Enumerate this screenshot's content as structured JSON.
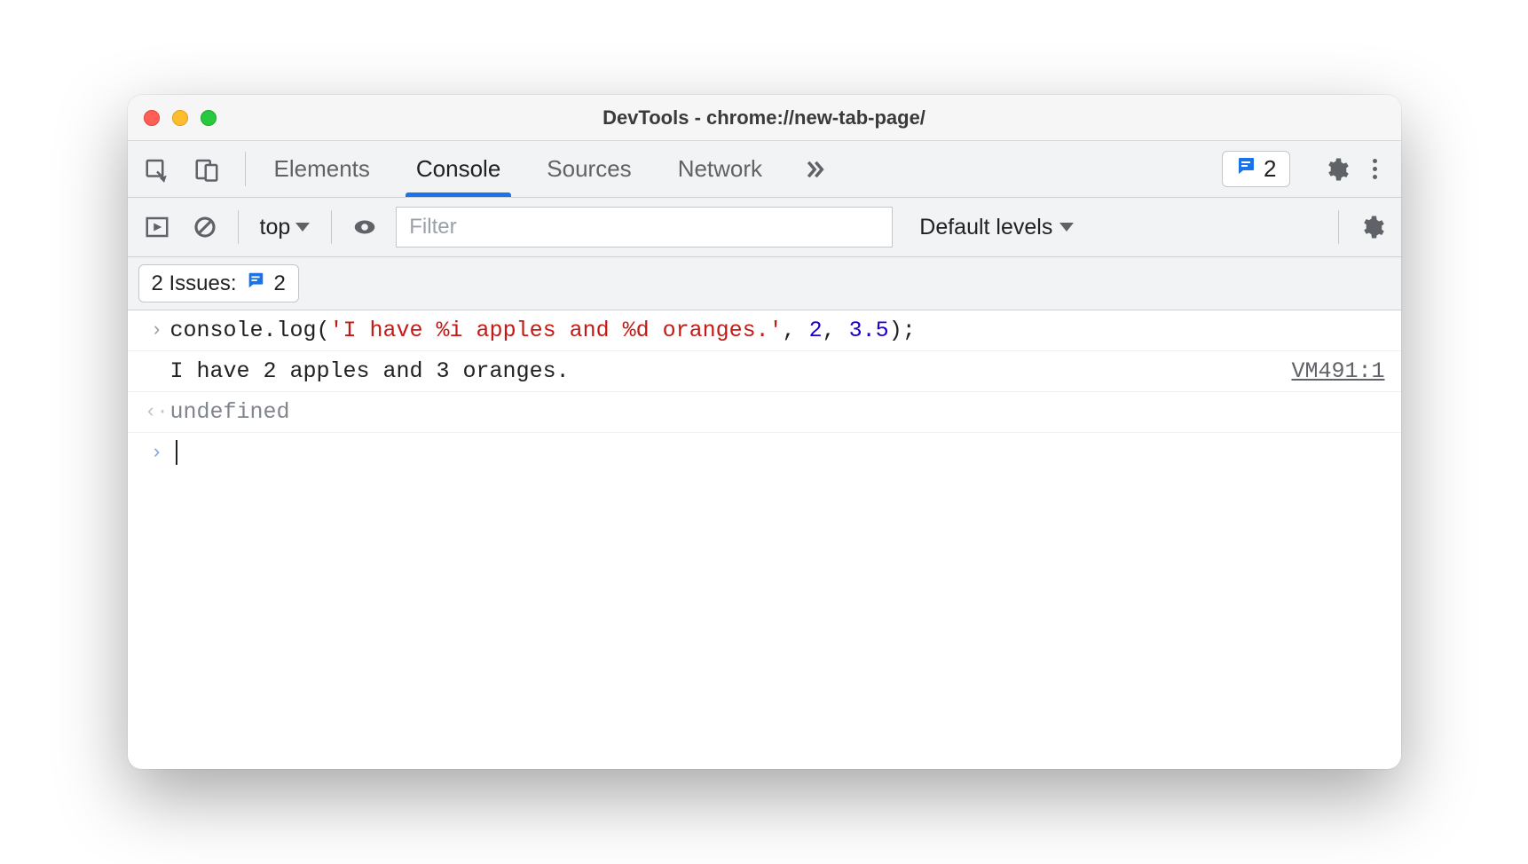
{
  "window": {
    "title": "DevTools - chrome://new-tab-page/"
  },
  "tabs": {
    "elements": "Elements",
    "console": "Console",
    "sources": "Sources",
    "network": "Network",
    "active": "console"
  },
  "issues_count": "2",
  "toolbar": {
    "context": "top",
    "filter_placeholder": "Filter",
    "levels": "Default levels"
  },
  "issues_chip": {
    "label": "2 Issues:",
    "count": "2"
  },
  "console": {
    "input": {
      "fn": "console.log(",
      "str": "'I have %i apples and %d oranges.'",
      "sep1": ", ",
      "arg1": "2",
      "sep2": ", ",
      "arg2": "3.5",
      "close": ");"
    },
    "output": {
      "text": "I have 2 apples and 3 oranges.",
      "source": "VM491:1"
    },
    "return": "undefined"
  }
}
